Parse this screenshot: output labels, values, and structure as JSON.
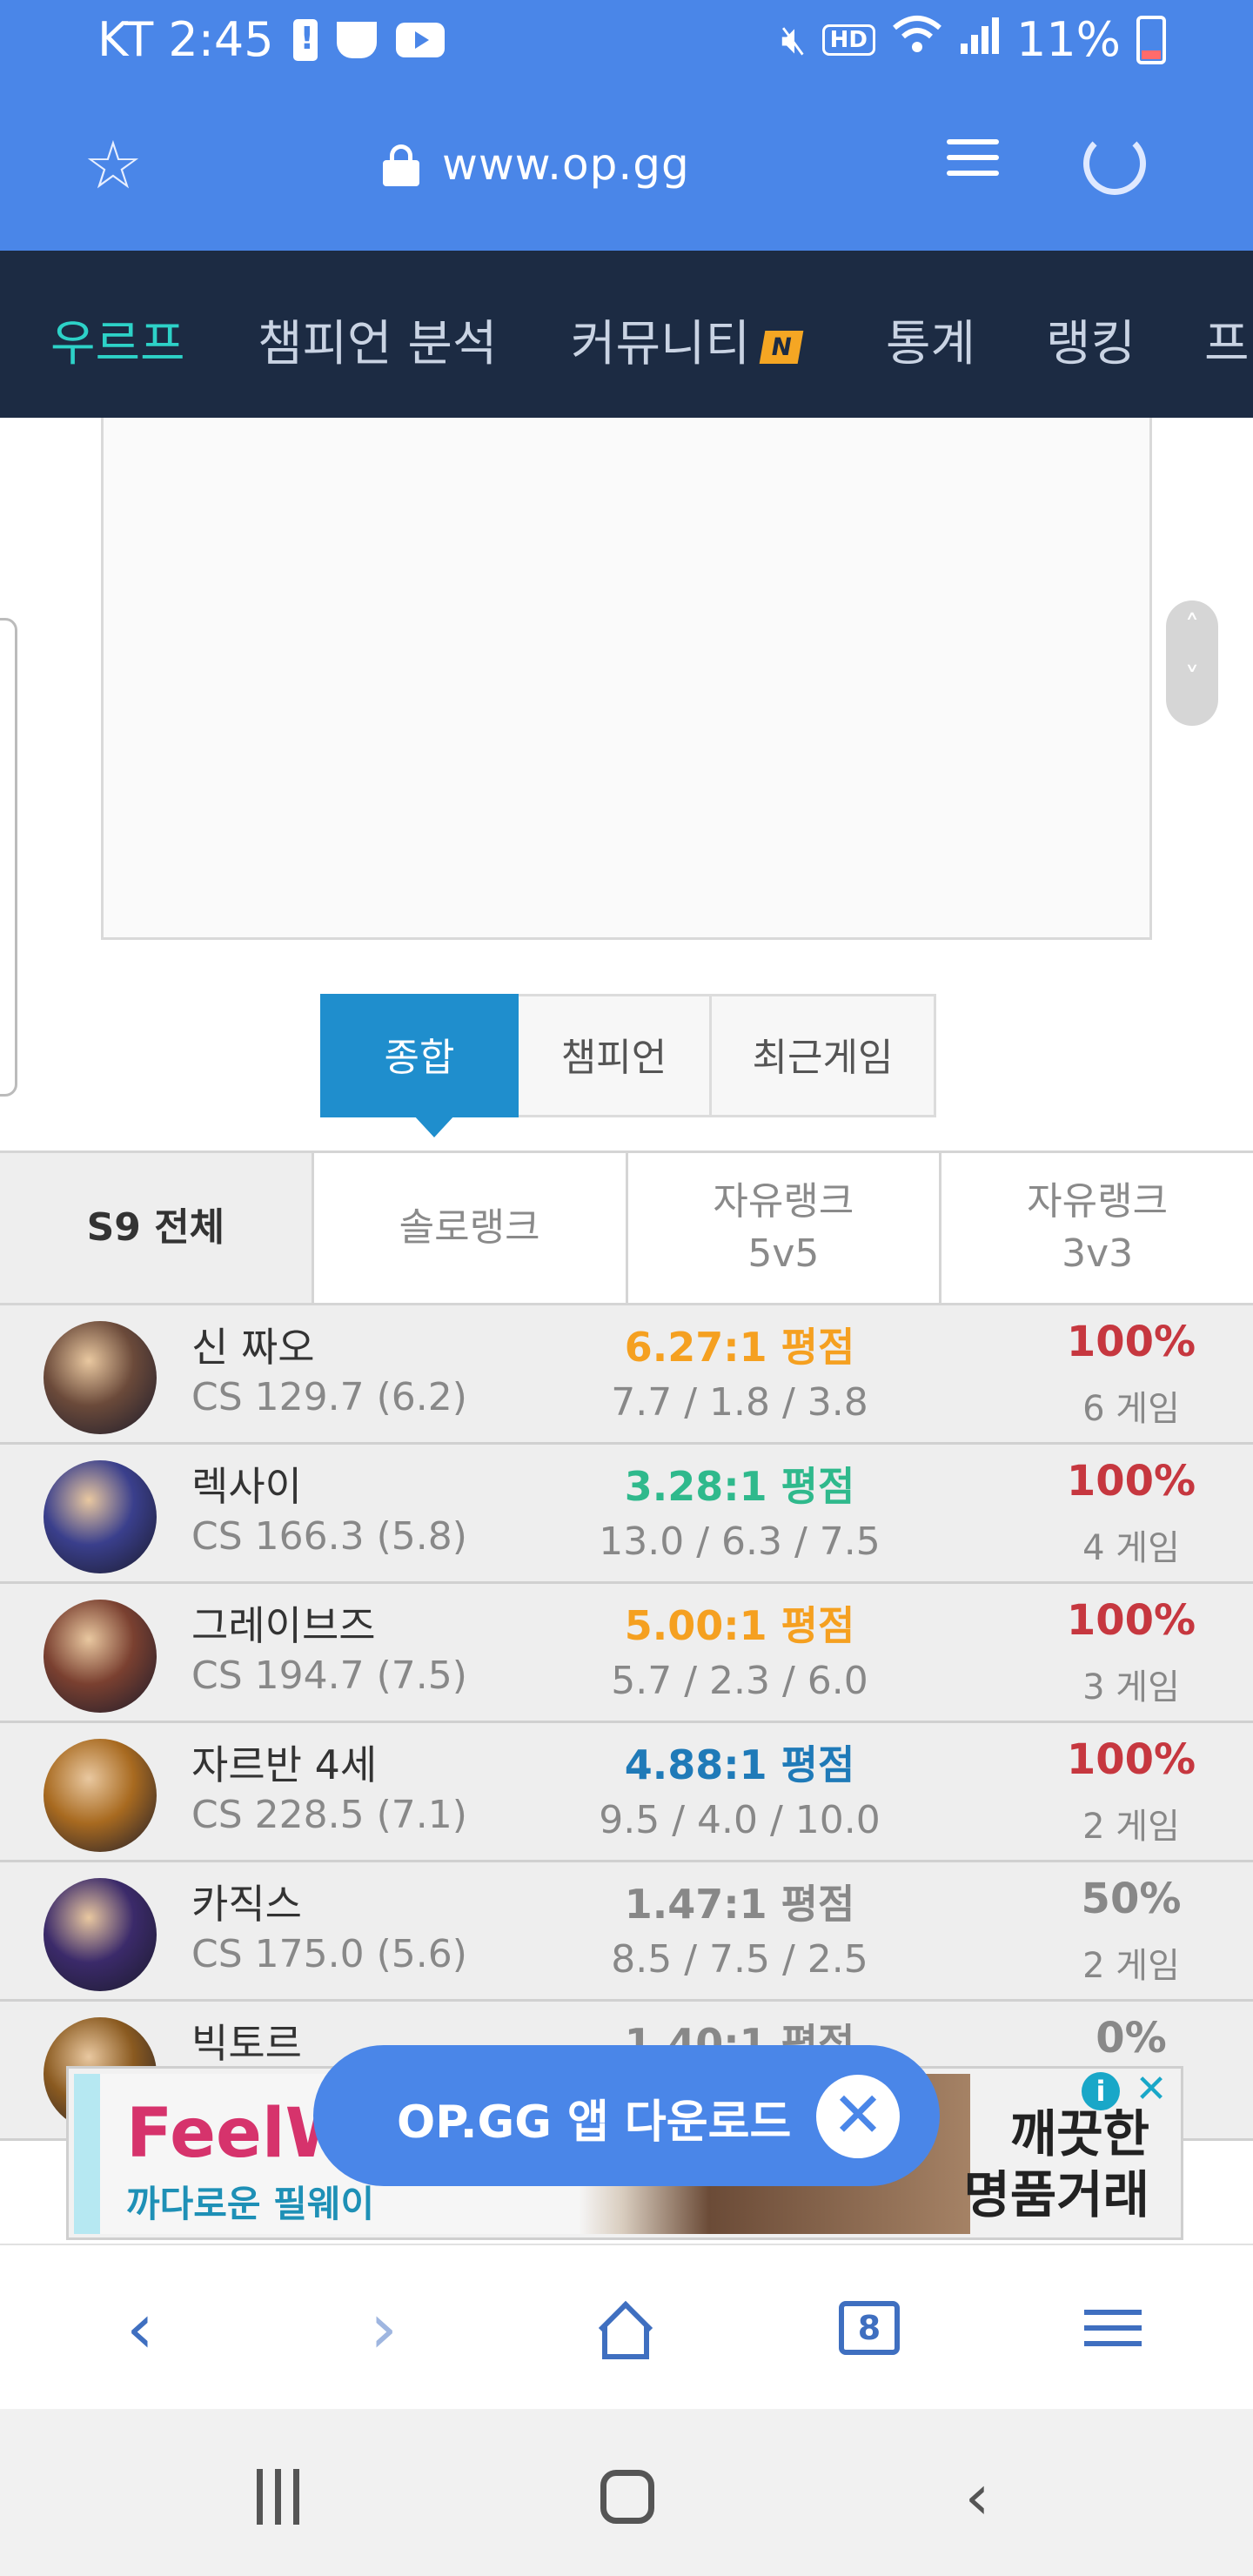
{
  "status_bar": {
    "carrier_time": "KT 2:45",
    "battery_percent": "11%",
    "hd_label": "HD",
    "icons": [
      "battery-alert-icon",
      "cup-icon",
      "youtube-icon",
      "mute-icon",
      "wifi-icon",
      "signal-icon",
      "battery-icon"
    ]
  },
  "url_bar": {
    "url": "www.op.gg"
  },
  "site_nav": {
    "items": [
      {
        "label": "우르프",
        "active": true
      },
      {
        "label": "챔피언 분석"
      },
      {
        "label": "커뮤니티",
        "badge": "N"
      },
      {
        "label": "통계"
      },
      {
        "label": "랭킹"
      },
      {
        "label": "프"
      }
    ]
  },
  "view_tabs": {
    "items": [
      {
        "label": "종합",
        "active": true
      },
      {
        "label": "챔피언"
      },
      {
        "label": "최근게임"
      }
    ]
  },
  "season_tabs": {
    "items": [
      {
        "line1": "S9 전체",
        "line2": "",
        "active": true
      },
      {
        "line1": "솔로랭크",
        "line2": ""
      },
      {
        "line1": "자유랭크",
        "line2": "5v5"
      },
      {
        "line1": "자유랭크",
        "line2": "3v3"
      }
    ]
  },
  "champions": [
    {
      "name": "신 짜오",
      "cs": "CS 129.7 (6.2)",
      "ratio": "6.27:1 평점",
      "ratio_color": "#f5a020",
      "kda": "7.7 / 1.8 / 3.8",
      "winrate": "100%",
      "wr_color": "#c6373f",
      "games": "6 게임",
      "avatar_color": "#6b4a3a"
    },
    {
      "name": "렉사이",
      "cs": "CS 166.3 (5.8)",
      "ratio": "3.28:1 평점",
      "ratio_color": "#2fb98c",
      "kda": "13.0 / 6.3 / 7.5",
      "winrate": "100%",
      "wr_color": "#c6373f",
      "games": "4 게임",
      "avatar_color": "#3a3f8c"
    },
    {
      "name": "그레이브즈",
      "cs": "CS 194.7 (7.5)",
      "ratio": "5.00:1 평점",
      "ratio_color": "#f5a020",
      "kda": "5.7 / 2.3 / 6.0",
      "winrate": "100%",
      "wr_color": "#c6373f",
      "games": "3 게임",
      "avatar_color": "#7a4030"
    },
    {
      "name": "자르반 4세",
      "cs": "CS 228.5 (7.1)",
      "ratio": "4.88:1 평점",
      "ratio_color": "#1f7ab8",
      "kda": "9.5 / 4.0 / 10.0",
      "winrate": "100%",
      "wr_color": "#c6373f",
      "games": "2 게임",
      "avatar_color": "#a86a20"
    },
    {
      "name": "카직스",
      "cs": "CS 175.0 (5.6)",
      "ratio": "1.47:1 평점",
      "ratio_color": "#888888",
      "kda": "8.5 / 7.5 / 2.5",
      "winrate": "50%",
      "wr_color": "#888888",
      "games": "2 게임",
      "avatar_color": "#3b2a6a"
    },
    {
      "name": "빅토르",
      "cs": "",
      "ratio": "1.40:1 평점",
      "ratio_color": "#888888",
      "kda": "",
      "winrate": "0%",
      "wr_color": "#888888",
      "games": "",
      "avatar_color": "#8a5a20"
    }
  ],
  "ad_banner": {
    "brand": "FeelW",
    "sub": "까다로운 필웨이",
    "right_line1": "깨끗한",
    "right_line2": "명품거래",
    "info_glyph": "i",
    "close_glyph": "✕"
  },
  "app_download": {
    "label": "OP.GG 앱 다운로드",
    "close_glyph": "✕"
  },
  "browser_bar": {
    "back_glyph": "‹",
    "forward_glyph": "›",
    "tab_count": "8"
  },
  "android_nav": {
    "back_glyph": "‹"
  }
}
